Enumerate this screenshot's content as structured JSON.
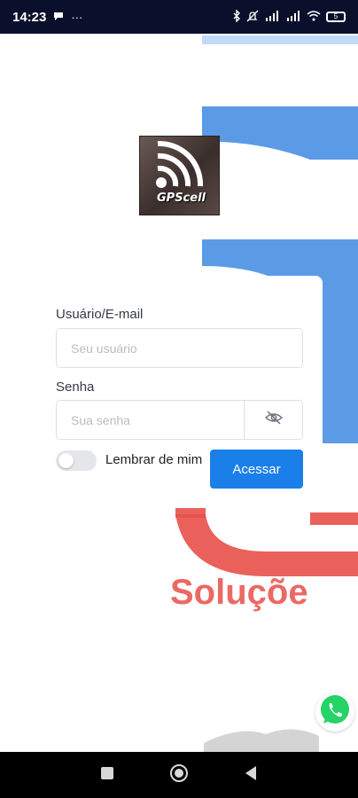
{
  "status_bar": {
    "time": "14:23",
    "left_icons": [
      "chat-bubble-icon",
      "more-dots-icon"
    ],
    "right_icons": [
      "bluetooth-icon",
      "mute-icon",
      "signal-4g-icon",
      "signal-4g-icon",
      "wifi-icon",
      "battery-icon"
    ],
    "battery_level": "5"
  },
  "brand": {
    "logo_text": "GPScell",
    "background_word": "Soluçõe"
  },
  "login": {
    "username_label": "Usuário/E-mail",
    "username_placeholder": "Seu usuário",
    "username_value": "",
    "password_label": "Senha",
    "password_placeholder": "Sua senha",
    "password_value": "",
    "remember_label": "Lembrar de mim",
    "remember_checked": false,
    "submit_label": "Acessar"
  },
  "colors": {
    "accent": "#1a7fe8",
    "status_bar_bg": "#0a0f2c",
    "bg_blue": "#5b9be6",
    "bg_red": "#e8504a",
    "whatsapp": "#25d366"
  },
  "nav": {
    "buttons": [
      "recent-apps-icon",
      "home-icon",
      "back-icon"
    ]
  }
}
